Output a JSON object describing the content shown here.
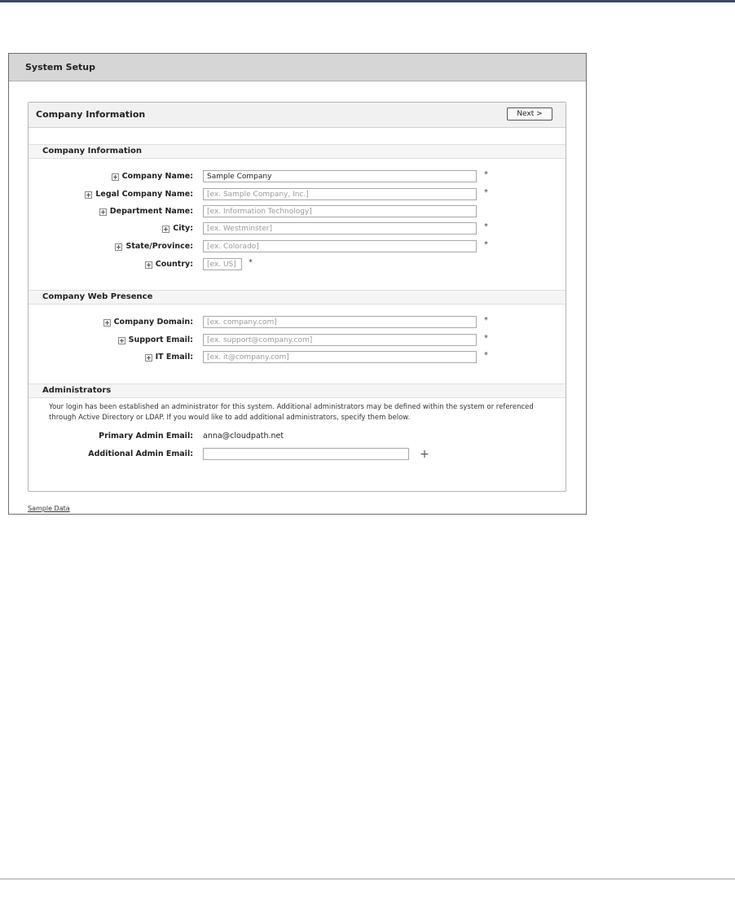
{
  "window": {
    "title": "System Setup"
  },
  "panel": {
    "title": "Company Information",
    "next_label": "Next >"
  },
  "company_info": {
    "title": "Company Information",
    "fields": [
      {
        "label": "Company Name:",
        "value": "Sample Company",
        "placeholder": "",
        "required": "*"
      },
      {
        "label": "Legal Company Name:",
        "value": "",
        "placeholder": "[ex. Sample Company, Inc.]",
        "required": "*"
      },
      {
        "label": "Department Name:",
        "value": "",
        "placeholder": "[ex. Information Technology]",
        "required": ""
      },
      {
        "label": "City:",
        "value": "",
        "placeholder": "[ex. Westminster]",
        "required": "*"
      },
      {
        "label": "State/Province:",
        "value": "",
        "placeholder": "[ex. Colorado]",
        "required": "*"
      },
      {
        "label": "Country:",
        "value": "",
        "placeholder": "[ex. US]",
        "required": "*"
      }
    ]
  },
  "web_presence": {
    "title": "Company Web Presence",
    "fields": [
      {
        "label": "Company Domain:",
        "value": "",
        "placeholder": "[ex. company.com]",
        "required": "*"
      },
      {
        "label": "Support Email:",
        "value": "",
        "placeholder": "[ex. support@company.com]",
        "required": "*"
      },
      {
        "label": "IT Email:",
        "value": "",
        "placeholder": "[ex. it@company.com]",
        "required": "*"
      }
    ]
  },
  "administrators": {
    "title": "Administrators",
    "description": "Your login has been established an administrator for this system. Additional administrators may be defined within the system or referenced through Active Directory or LDAP. If you would like to add additional administrators, specify them below.",
    "primary_label": "Primary Admin Email:",
    "primary_value": "anna@cloudpath.net",
    "additional_label": "Additional Admin Email:",
    "additional_value": "",
    "add_icon": "plus-icon"
  },
  "footer": {
    "sample_data_link": "Sample Data"
  },
  "colors": {
    "header_bg": "#d6d6d6",
    "top_bar": "#3b4a63",
    "panel_header_bg": "#f1f1f1"
  }
}
